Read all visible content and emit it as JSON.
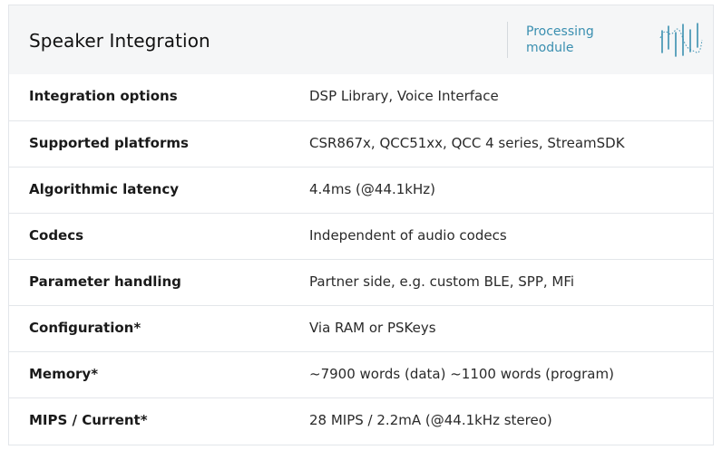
{
  "header": {
    "title": "Speaker Integration",
    "module_label": "Processing module",
    "logo_icon": "waveform-logo-icon",
    "accent_color": "#3a8fb0"
  },
  "rows": [
    {
      "label": "Integration options",
      "value": "DSP Library, Voice Interface"
    },
    {
      "label": "Supported platforms",
      "value": "CSR867x, QCC51xx, QCC 4 series, StreamSDK"
    },
    {
      "label": "Algorithmic latency",
      "value": "4.4ms (@44.1kHz)"
    },
    {
      "label": "Codecs",
      "value": "Independent of audio codecs"
    },
    {
      "label": "Parameter handling",
      "value": "Partner side, e.g. custom BLE, SPP, MFi"
    },
    {
      "label": "Configuration*",
      "value": "Via RAM or PSKeys"
    },
    {
      "label": "Memory*",
      "value": "~7900 words (data) ~1100 words (program)"
    },
    {
      "label": "MIPS / Current*",
      "value": "28 MIPS / 2.2mA (@44.1kHz stereo)"
    }
  ]
}
